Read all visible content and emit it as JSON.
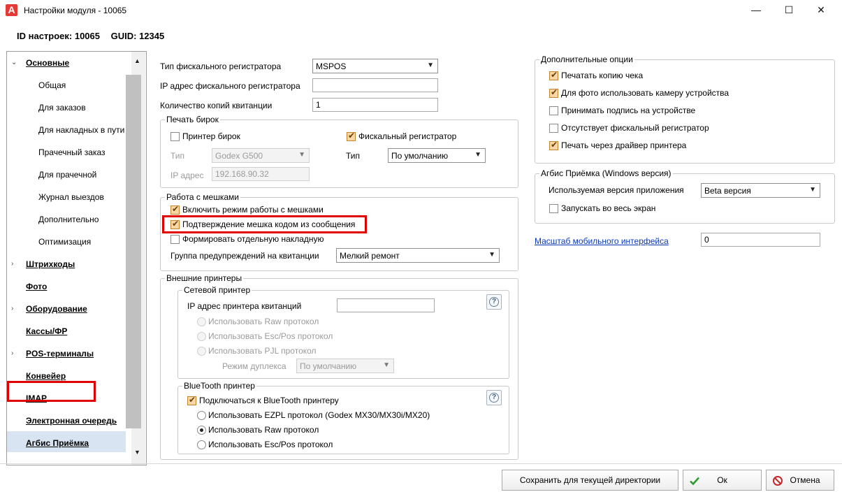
{
  "window": {
    "title": "Настройки модуля - 10065",
    "app_icon": "A",
    "buttons": {
      "minimize": "—",
      "maximize": "☐",
      "close": "✕"
    }
  },
  "header": {
    "id_label": "ID настроек: 10065",
    "guid_label": "GUID: 12345"
  },
  "nav": {
    "items": [
      {
        "label": "Основные",
        "type": "parent",
        "arrow": "⌄"
      },
      {
        "label": "Общая",
        "type": "child"
      },
      {
        "label": "Для заказов",
        "type": "child"
      },
      {
        "label": "Для накладных в пути",
        "type": "child"
      },
      {
        "label": "Прачечный заказ",
        "type": "child"
      },
      {
        "label": "Для прачечной",
        "type": "child"
      },
      {
        "label": "Журнал выездов",
        "type": "child"
      },
      {
        "label": "Дополнительно",
        "type": "child"
      },
      {
        "label": "Оптимизация",
        "type": "child"
      },
      {
        "label": "Штрихкоды",
        "type": "parent",
        "arrow": "›"
      },
      {
        "label": "Фото",
        "type": "parent",
        "arrow": ""
      },
      {
        "label": "Оборудование",
        "type": "parent",
        "arrow": "›"
      },
      {
        "label": "Кассы/ФР",
        "type": "parent",
        "arrow": ""
      },
      {
        "label": "POS-терминалы",
        "type": "parent",
        "arrow": "›"
      },
      {
        "label": "Конвейер",
        "type": "parent",
        "arrow": ""
      },
      {
        "label": "IMAP",
        "type": "parent",
        "arrow": ""
      },
      {
        "label": "Электронная очередь",
        "type": "parent",
        "arrow": ""
      },
      {
        "label": "Агбис Приёмка",
        "type": "parent",
        "arrow": "",
        "selected": true
      }
    ],
    "scroll_up": "▲",
    "scroll_down": "▼"
  },
  "fiscal": {
    "type_label": "Тип фискального регистратора",
    "type_value": "MSPOS",
    "ip_label": "IP адрес фискального регистратора",
    "ip_value": "",
    "copies_label": "Количество копий квитанции",
    "copies_value": "1"
  },
  "tags": {
    "title": "Печать бирок",
    "printer_label": "Принтер бирок",
    "printer_checked": false,
    "fiscal_label": "Фискальный регистратор",
    "fiscal_checked": true,
    "type_label_left": "Тип",
    "type_value_left": "Godex G500",
    "ip_label": "IP адрес",
    "ip_value": "192.168.90.32",
    "type_label_right": "Тип",
    "type_value_right": "По умолчанию"
  },
  "bags": {
    "title": "Работа с мешками",
    "enable_label": "Включить режим работы с мешками",
    "enable_checked": true,
    "confirm_label": "Подтверждение мешка кодом из сообщения",
    "confirm_checked": true,
    "separate_label": "Формировать отдельную накладную",
    "separate_checked": false,
    "warn_group_label": "Группа предупреждений на квитанции",
    "warn_group_value": "Мелкий ремонт"
  },
  "ext_printers": {
    "title": "Внешние принтеры",
    "network": {
      "title": "Сетевой принтер",
      "ip_label": "IP адрес принтера квитанций",
      "ip_value": "",
      "raw_label": "Использовать Raw протокол",
      "escpos_label": "Использовать Esc/Pos протокол",
      "pjl_label": "Использовать PJL протокол",
      "duplex_label": "Режим дуплекса",
      "duplex_value": "По умолчанию"
    },
    "bluetooth": {
      "title": "BlueTooth принтер",
      "connect_label": "Подключаться к BlueTooth принтеру",
      "connect_checked": true,
      "ezpl_label": "Использовать EZPL протокол (Godex MX30/MX30i/MX20)",
      "raw_label": "Использовать Raw протокол",
      "escpos_label": "Использовать Esc/Pos протокол",
      "selected": "raw"
    },
    "help_glyph": "?"
  },
  "extra": {
    "title": "Дополнительные опции",
    "options": [
      {
        "label": "Печатать копию чека",
        "checked": true
      },
      {
        "label": "Для фото использовать камеру устройства",
        "checked": true
      },
      {
        "label": "Принимать подпись на устройстве",
        "checked": false
      },
      {
        "label": "Отсутствует фискальный регистратор",
        "checked": false
      },
      {
        "label": "Печать через драйвер принтера",
        "checked": true
      }
    ]
  },
  "agbis_win": {
    "title": "Агбис Приёмка (Windows версия)",
    "version_label": "Используемая версия приложения",
    "version_value": "Beta версия",
    "fullscreen_label": "Запускать во весь экран",
    "fullscreen_checked": false
  },
  "mobile_scale": {
    "label": "Масштаб мобильного интерфейса",
    "value": "0"
  },
  "footer": {
    "save_label": "Сохранить для текущей директории",
    "ok_label": "Ок",
    "cancel_label": "Отмена"
  },
  "colors": {
    "accent_red": "#e00000",
    "link": "#0b39b8",
    "checkbox_fill": "#f7d7a8",
    "nav_selected": "#d9e4f2",
    "ok_green": "#2e9b2e"
  }
}
